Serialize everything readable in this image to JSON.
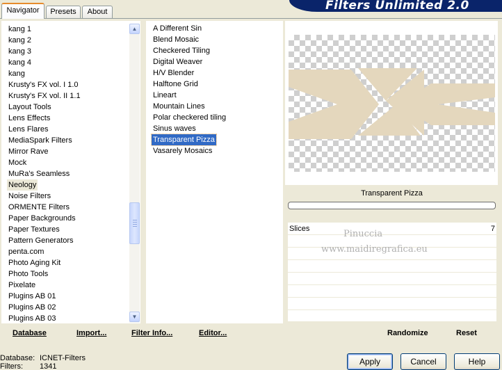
{
  "tabs": [
    {
      "label": "Navigator",
      "active": true
    },
    {
      "label": "Presets",
      "active": false
    },
    {
      "label": "About",
      "active": false
    }
  ],
  "banner": {
    "title": "Filters Unlimited 2.0"
  },
  "categories": {
    "selected_index": 14,
    "items": [
      "kang 1",
      "kang 2",
      "kang 3",
      "kang 4",
      "kang",
      "Krusty's FX vol. I 1.0",
      "Krusty's FX vol. II 1.1",
      "Layout Tools",
      "Lens Effects",
      "Lens Flares",
      "MediaSpark Filters",
      "Mirror Rave",
      "Mock",
      "MuRa's Seamless",
      "Neology",
      "Noise Filters",
      "ORMENTE Filters",
      "Paper Backgrounds",
      "Paper Textures",
      "Pattern Generators",
      "penta.com",
      "Photo Aging Kit",
      "Photo Tools",
      "Pixelate",
      "Plugins AB 01",
      "Plugins AB 02",
      "Plugins AB 03"
    ]
  },
  "filters": {
    "selected_index": 10,
    "items": [
      "A Different Sin",
      "Blend Mosaic",
      "Checkered Tiling",
      "Digital Weaver",
      "H/V Blender",
      "Halftone Grid",
      "Lineart",
      "Mountain Lines",
      "Polar checkered tiling",
      "Sinus waves",
      "Transparent Pizza",
      "Vasarely Mosaics"
    ]
  },
  "preview": {
    "shape_color": "#e4d7bd"
  },
  "filter_name": "Transparent Pizza",
  "parameters": [
    {
      "label": "Slices",
      "value": "7"
    }
  ],
  "watermark": {
    "line1": "Pinuccia",
    "line2": "www.maidiregrafica.eu"
  },
  "toolbar": {
    "database": "Database",
    "import": "Import...",
    "filter_info": "Filter Info...",
    "editor": "Editor...",
    "randomize": "Randomize",
    "reset": "Reset"
  },
  "status": {
    "database_label": "Database:",
    "database_value": "ICNET-Filters",
    "filters_label": "Filters:",
    "filters_value": "1341"
  },
  "buttons": {
    "apply": "Apply",
    "cancel": "Cancel",
    "help": "Help"
  }
}
